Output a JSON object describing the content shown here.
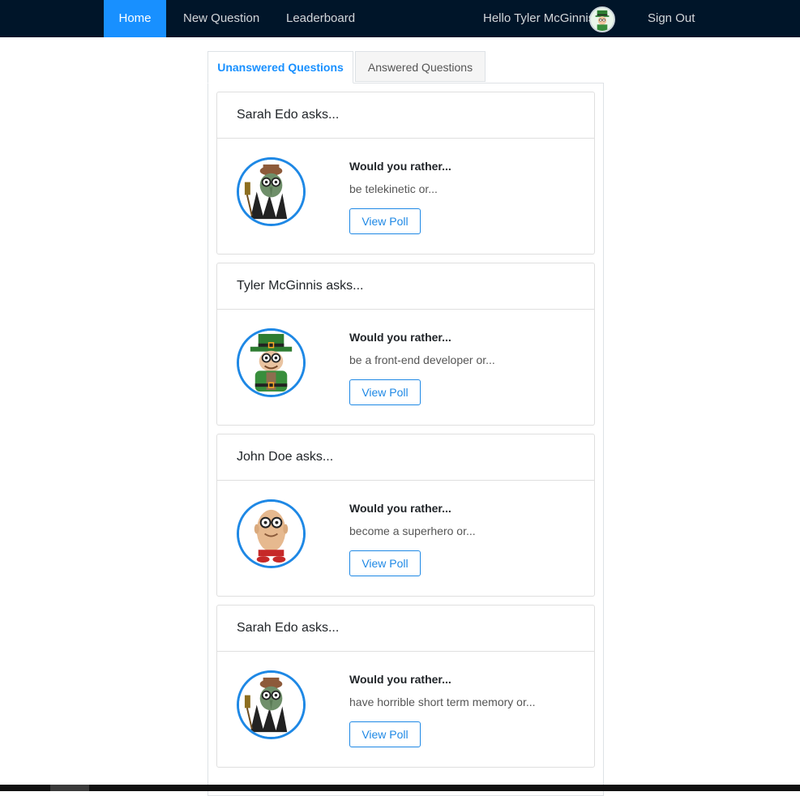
{
  "nav": {
    "home": "Home",
    "new_question": "New Question",
    "leaderboard": "Leaderboard",
    "greeting": "Hello Tyler McGinnis",
    "sign_out": "Sign Out",
    "avatar_icon": "leprechaun-avatar-icon"
  },
  "tabs": {
    "unanswered": "Unanswered Questions",
    "answered": "Answered Questions"
  },
  "colors": {
    "navbar": "#001529",
    "accent": "#1890ff",
    "button_blue": "#1e88e5"
  },
  "questions": [
    {
      "author_line": "Sarah Edo asks...",
      "prompt": "Would you rather...",
      "option": "be telekinetic or...",
      "button": "View Poll",
      "avatar": "witch-avatar-icon"
    },
    {
      "author_line": "Tyler McGinnis asks...",
      "prompt": "Would you rather...",
      "option": "be a front-end developer or...",
      "button": "View Poll",
      "avatar": "leprechaun-avatar-icon"
    },
    {
      "author_line": "John Doe asks...",
      "prompt": "Would you rather...",
      "option": "become a superhero or...",
      "button": "View Poll",
      "avatar": "bald-man-avatar-icon"
    },
    {
      "author_line": "Sarah Edo asks...",
      "prompt": "Would you rather...",
      "option": "have horrible short term memory or...",
      "button": "View Poll",
      "avatar": "witch-avatar-icon"
    }
  ]
}
